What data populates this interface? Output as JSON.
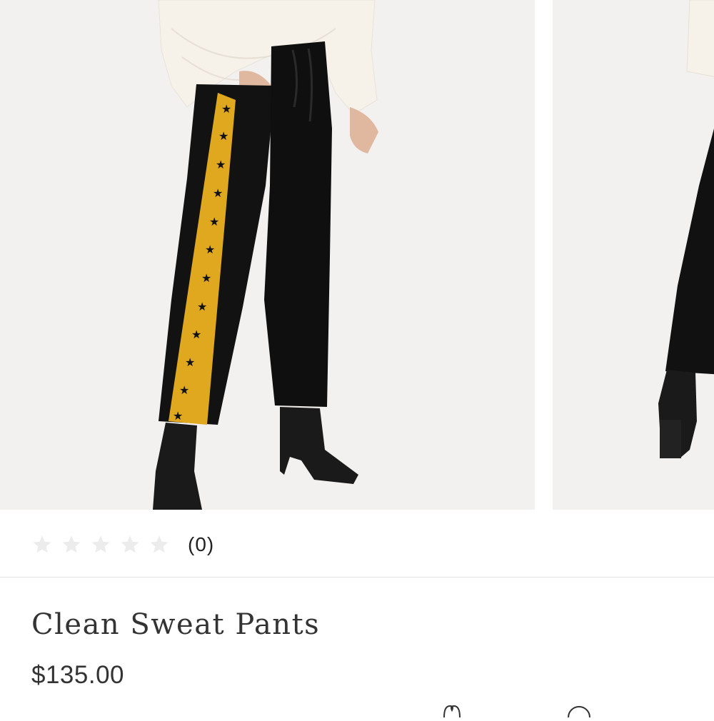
{
  "gallery": {
    "images": [
      {
        "alt": "Clean Sweat Pants front view",
        "icon": "product-photo"
      },
      {
        "alt": "Clean Sweat Pants side view",
        "icon": "product-photo"
      }
    ]
  },
  "rating": {
    "stars_filled": 0,
    "stars_total": 5,
    "count_label": "(0)",
    "star_color": "#e6e6e6"
  },
  "product": {
    "name": "Clean Sweat Pants",
    "price": "$135.00"
  },
  "colors": {
    "background": "#ffffff",
    "photo_background": "#f3f1ef",
    "text": "#333333",
    "stripe_accent": "#e0a81e",
    "divider": "#e2e2e2"
  },
  "actions": [
    {
      "icon": "favorite-icon"
    },
    {
      "icon": "info-icon"
    }
  ]
}
